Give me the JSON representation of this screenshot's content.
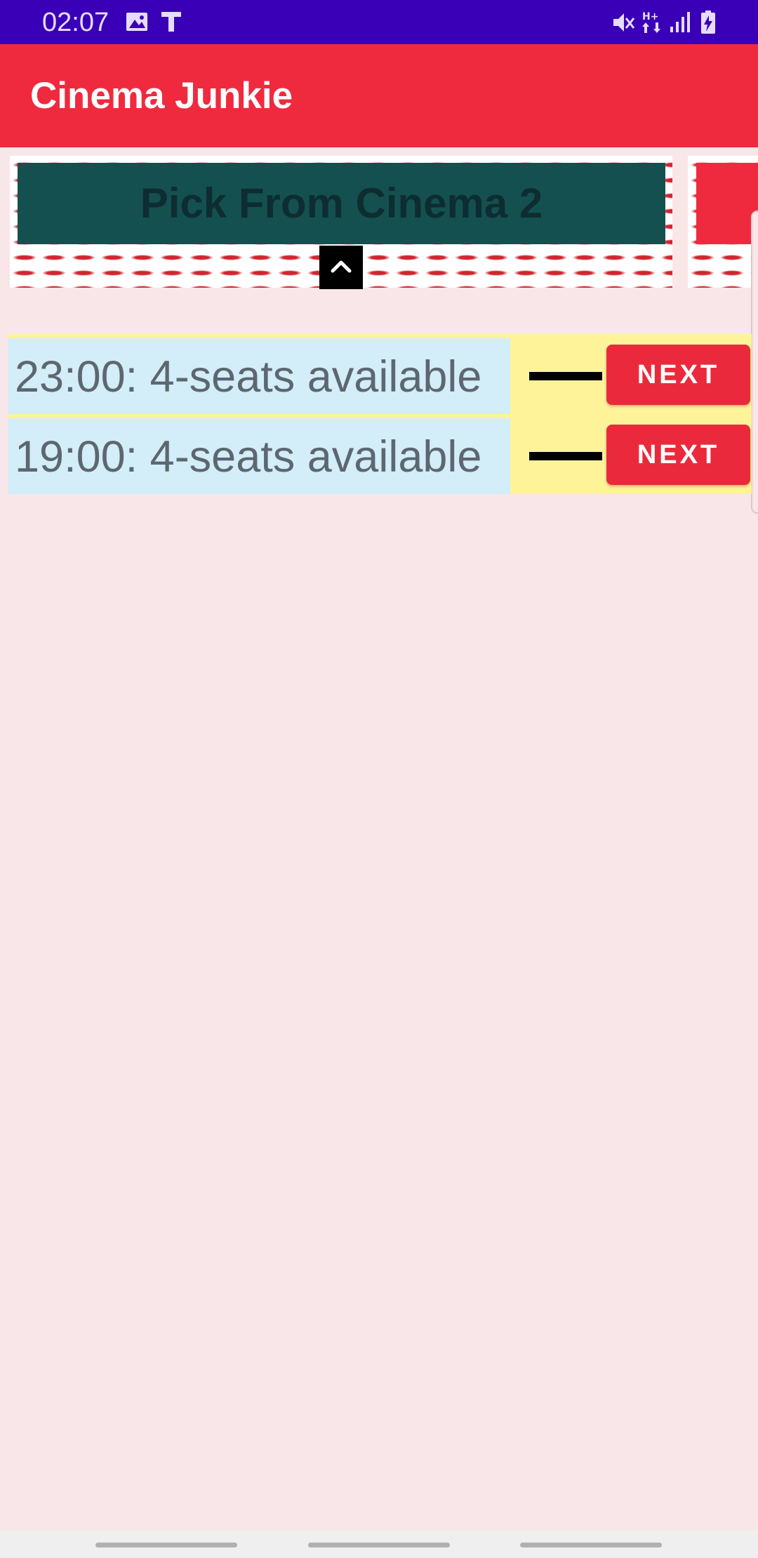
{
  "status_bar": {
    "time": "02:07",
    "left_icons": [
      "image-icon",
      "text-icon"
    ],
    "right_icons": [
      "mute-icon",
      "data-transfer-icon",
      "signal-icon",
      "battery-charging-icon"
    ],
    "color": "#3a00b7"
  },
  "app_bar": {
    "title": "Cinema Junkie",
    "color": "#f02a3e"
  },
  "carousel": {
    "banner_label": "Pick From Cinema 2",
    "banner_color": "#145050",
    "collapse_icon": "chevron-up-icon"
  },
  "showtimes": [
    {
      "label": "23:00: 4-seats available",
      "button": "NEXT"
    },
    {
      "label": "19:00: 4-seats available",
      "button": "NEXT"
    }
  ],
  "colors": {
    "background": "#f9e6e8",
    "list_background": "#fff39a",
    "row_label_background": "#d3edf9",
    "next_button": "#ea2a3c"
  }
}
